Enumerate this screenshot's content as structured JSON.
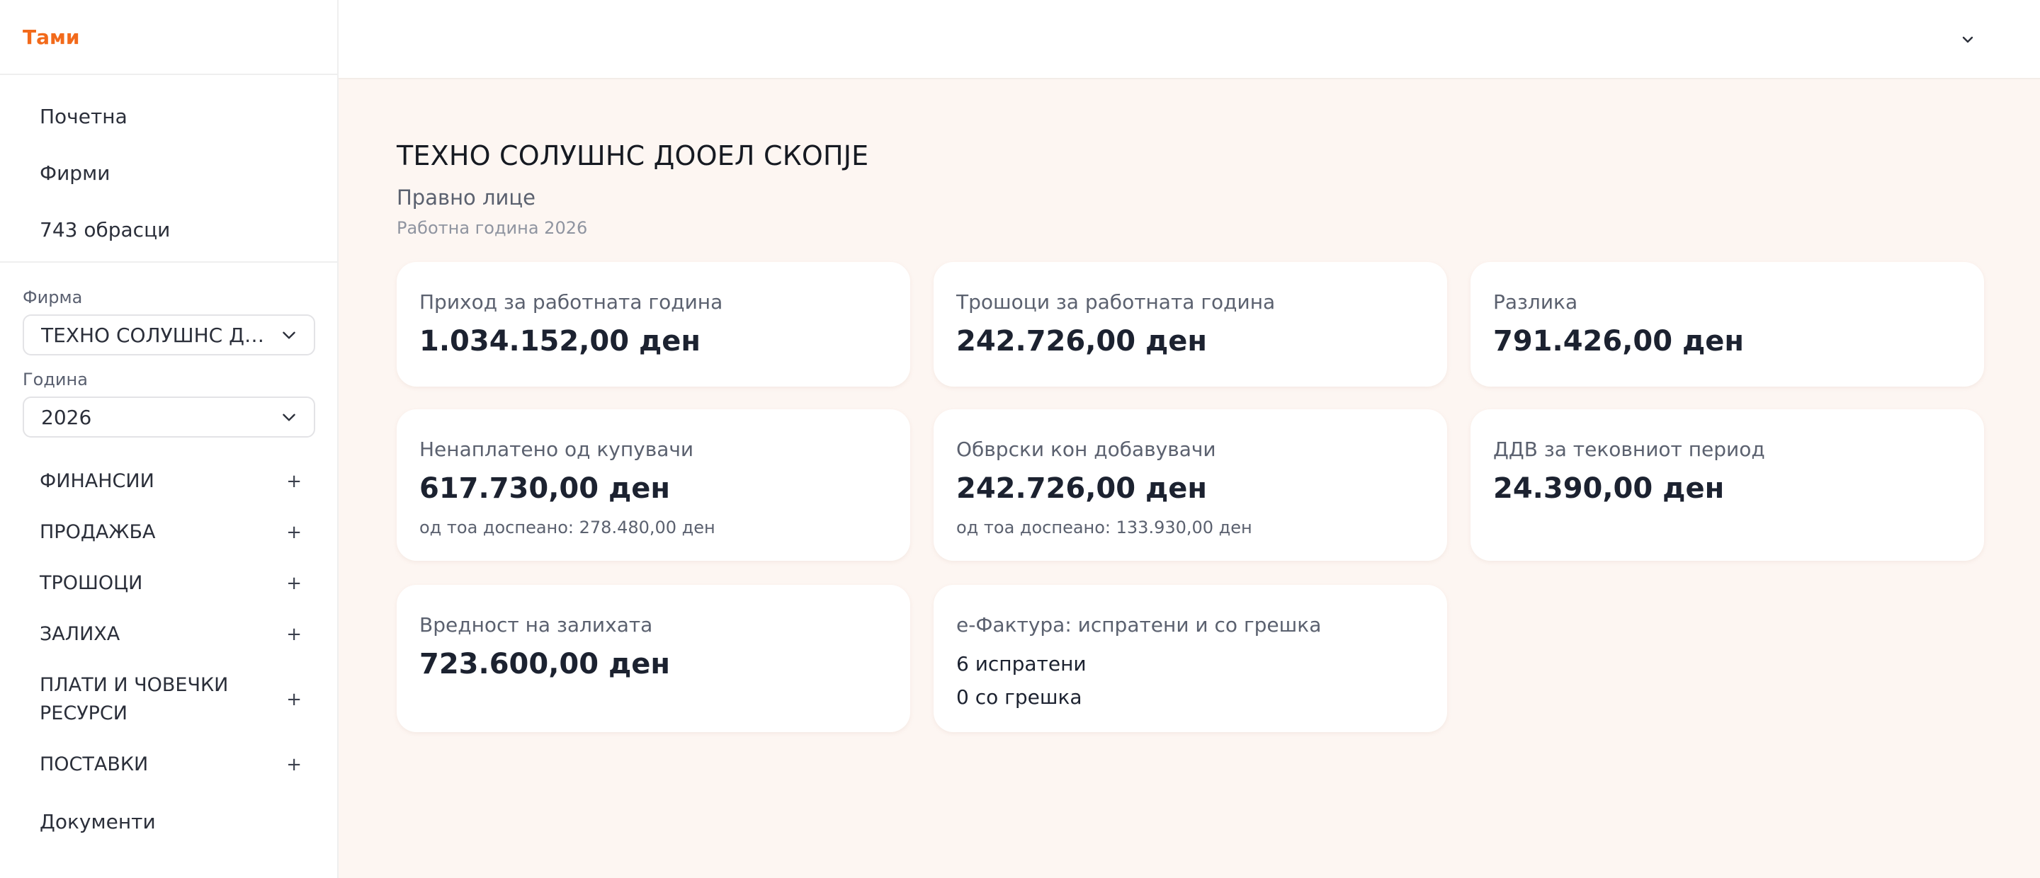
{
  "app": {
    "brand": "Тами"
  },
  "sidebar": {
    "nav": [
      "Почетна",
      "Фирми",
      "743 обрасци"
    ],
    "firm": {
      "label": "Фирма",
      "value": "ТЕХНО СОЛУШНС ДООЕЛ СКОПЈЕ"
    },
    "year": {
      "label": "Година",
      "value": "2026"
    },
    "sections": [
      "ФИНАНСИИ",
      "ПРОДАЖБА",
      "ТРОШОЦИ",
      "ЗАЛИХА",
      "ПЛАТИ И ЧОВЕЧКИ РЕСУРСИ",
      "ПОСТАВКИ"
    ],
    "section_icon": "+",
    "documents": "Документи"
  },
  "topbar": {
    "menu_icon": "chevron-down-icon"
  },
  "main": {
    "company": "ТЕХНО СОЛУШНС ДООЕЛ СКОПЈЕ",
    "entity_type": "Правно лице",
    "working_year": "Работна година 2026",
    "cards": {
      "income": {
        "title": "Приход за работната година",
        "value": "1.034.152,00 ден"
      },
      "expenses": {
        "title": "Трошоци за работната година",
        "value": "242.726,00 ден"
      },
      "difference": {
        "title": "Разлика",
        "value": "791.426,00 ден"
      },
      "unpaid": {
        "title": "Ненаплатено од купувачи",
        "value": "617.730,00 ден",
        "sub": "од тоа доспеано: 278.480,00 ден"
      },
      "obligations": {
        "title": "Обврски кон добавувачи",
        "value": "242.726,00 ден",
        "sub": "од тоа доспеано: 133.930,00 ден"
      },
      "vat": {
        "title": "ДДВ за тековниот период",
        "value": "24.390,00 ден"
      },
      "inventory": {
        "title": "Вредност на залихата",
        "value": "723.600,00 ден"
      },
      "einvoice": {
        "title": "е-Фактура: испратени и со грешка",
        "sent": "6 испратени",
        "errors": "0 со грешка"
      }
    }
  },
  "colors": {
    "brand": "#f26a1b",
    "main_bg": "#fdf6f2",
    "card_bg": "#ffffff"
  }
}
